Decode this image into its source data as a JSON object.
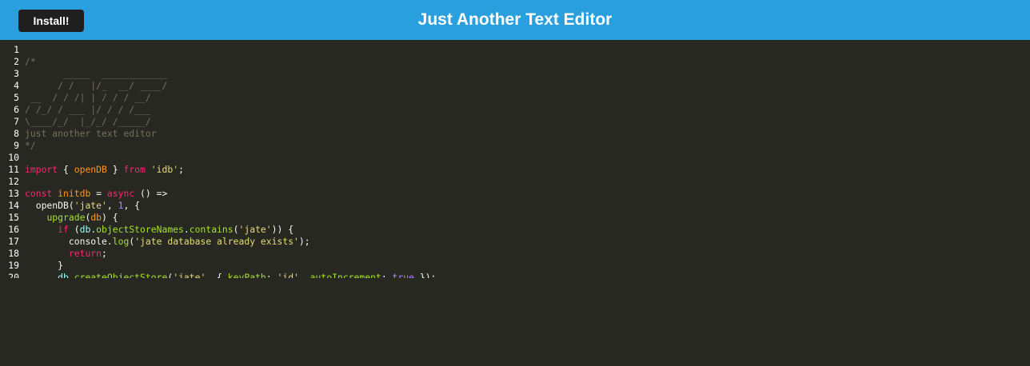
{
  "navbar": {
    "install_label": "Install!",
    "title": "Just Another Text Editor"
  },
  "colors": {
    "navbar_bg": "#2a9fdd",
    "editor_bg": "#272822",
    "comment": "#75715e",
    "keyword": "#f92672",
    "def": "#fd971f",
    "string": "#e6db74",
    "number": "#ae81ff",
    "property": "#a6e22e",
    "variable2": "#9effff",
    "text": "#f8f8f2"
  },
  "editor": {
    "lines": [
      {
        "num": "1",
        "tokens": []
      },
      {
        "num": "2",
        "tokens": [
          {
            "t": "comment",
            "v": "/*"
          }
        ]
      },
      {
        "num": "3",
        "tokens": [
          {
            "t": "comment",
            "v": "       _____  ____________"
          }
        ]
      },
      {
        "num": "4",
        "tokens": [
          {
            "t": "comment",
            "v": "      / /   |/_  __/ ____/"
          }
        ]
      },
      {
        "num": "5",
        "tokens": [
          {
            "t": "comment",
            "v": " __  / / /| | / / / __/"
          }
        ]
      },
      {
        "num": "6",
        "tokens": [
          {
            "t": "comment",
            "v": "/ /_/ / ___ |/ / / /___"
          }
        ]
      },
      {
        "num": "7",
        "tokens": [
          {
            "t": "comment",
            "v": "\\____/_/  |_/_/ /_____/"
          }
        ]
      },
      {
        "num": "8",
        "tokens": [
          {
            "t": "comment",
            "v": "just another text editor"
          }
        ]
      },
      {
        "num": "9",
        "tokens": [
          {
            "t": "comment",
            "v": "*/"
          }
        ]
      },
      {
        "num": "10",
        "tokens": []
      },
      {
        "num": "11",
        "tokens": [
          {
            "t": "keyword",
            "v": "import"
          },
          {
            "t": "punct",
            "v": " { "
          },
          {
            "t": "def",
            "v": "openDB"
          },
          {
            "t": "punct",
            "v": " } "
          },
          {
            "t": "keyword",
            "v": "from"
          },
          {
            "t": "punct",
            "v": " "
          },
          {
            "t": "string",
            "v": "'idb'"
          },
          {
            "t": "punct",
            "v": ";"
          }
        ]
      },
      {
        "num": "12",
        "tokens": []
      },
      {
        "num": "13",
        "tokens": [
          {
            "t": "keyword",
            "v": "const"
          },
          {
            "t": "punct",
            "v": " "
          },
          {
            "t": "def",
            "v": "initdb"
          },
          {
            "t": "punct",
            "v": " "
          },
          {
            "t": "operator",
            "v": "="
          },
          {
            "t": "punct",
            "v": " "
          },
          {
            "t": "keyword",
            "v": "async"
          },
          {
            "t": "punct",
            "v": " () "
          },
          {
            "t": "operator",
            "v": "=>"
          }
        ]
      },
      {
        "num": "14",
        "tokens": [
          {
            "t": "punct",
            "v": "  "
          },
          {
            "t": "variable",
            "v": "openDB"
          },
          {
            "t": "punct",
            "v": "("
          },
          {
            "t": "string",
            "v": "'jate'"
          },
          {
            "t": "punct",
            "v": ", "
          },
          {
            "t": "number",
            "v": "1"
          },
          {
            "t": "punct",
            "v": ", {"
          }
        ]
      },
      {
        "num": "15",
        "tokens": [
          {
            "t": "punct",
            "v": "    "
          },
          {
            "t": "property",
            "v": "upgrade"
          },
          {
            "t": "punct",
            "v": "("
          },
          {
            "t": "def",
            "v": "db"
          },
          {
            "t": "punct",
            "v": ") {"
          }
        ]
      },
      {
        "num": "16",
        "tokens": [
          {
            "t": "punct",
            "v": "      "
          },
          {
            "t": "keyword",
            "v": "if"
          },
          {
            "t": "punct",
            "v": " ("
          },
          {
            "t": "variable2",
            "v": "db"
          },
          {
            "t": "punct",
            "v": "."
          },
          {
            "t": "property",
            "v": "objectStoreNames"
          },
          {
            "t": "punct",
            "v": "."
          },
          {
            "t": "property",
            "v": "contains"
          },
          {
            "t": "punct",
            "v": "("
          },
          {
            "t": "string",
            "v": "'jate'"
          },
          {
            "t": "punct",
            "v": ")) {"
          }
        ]
      },
      {
        "num": "17",
        "tokens": [
          {
            "t": "punct",
            "v": "        "
          },
          {
            "t": "variable",
            "v": "console"
          },
          {
            "t": "punct",
            "v": "."
          },
          {
            "t": "property",
            "v": "log"
          },
          {
            "t": "punct",
            "v": "("
          },
          {
            "t": "string",
            "v": "'jate database already exists'"
          },
          {
            "t": "punct",
            "v": ");"
          }
        ]
      },
      {
        "num": "18",
        "tokens": [
          {
            "t": "punct",
            "v": "        "
          },
          {
            "t": "keyword",
            "v": "return"
          },
          {
            "t": "punct",
            "v": ";"
          }
        ]
      },
      {
        "num": "19",
        "tokens": [
          {
            "t": "punct",
            "v": "      }"
          }
        ]
      },
      {
        "num": "20",
        "tokens": [
          {
            "t": "punct",
            "v": "      "
          },
          {
            "t": "variable2",
            "v": "db"
          },
          {
            "t": "punct",
            "v": "."
          },
          {
            "t": "property",
            "v": "createObjectStore"
          },
          {
            "t": "punct",
            "v": "("
          },
          {
            "t": "string",
            "v": "'jate'"
          },
          {
            "t": "punct",
            "v": ", { "
          },
          {
            "t": "property",
            "v": "keyPath"
          },
          {
            "t": "punct",
            "v": ": "
          },
          {
            "t": "string",
            "v": "'id'"
          },
          {
            "t": "punct",
            "v": ", "
          },
          {
            "t": "property",
            "v": "autoIncrement"
          },
          {
            "t": "punct",
            "v": ": "
          },
          {
            "t": "atom",
            "v": "true"
          },
          {
            "t": "punct",
            "v": " });"
          }
        ]
      }
    ]
  }
}
